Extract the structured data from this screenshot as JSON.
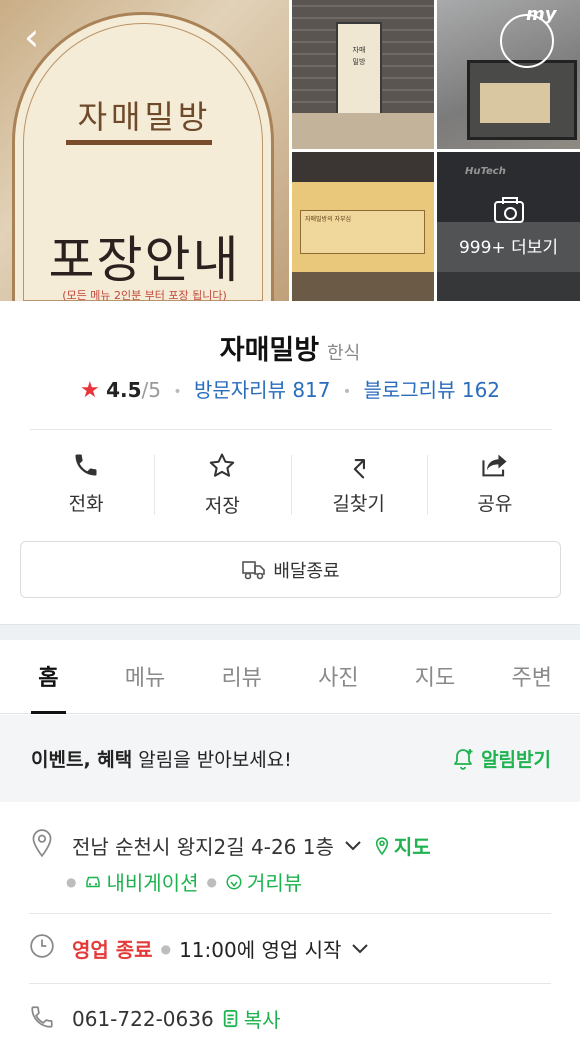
{
  "photos": {
    "poster_title": "자매밀방",
    "poster_heading": "포장안내",
    "poster_note": "(모든 메뉴 2인분 부터 포장 됩니다)",
    "more_label": "999+ 더보기",
    "my_logo_text": "my"
  },
  "place": {
    "name": "자매밀방",
    "category": "한식",
    "rating": "4.5",
    "rating_max": "/5",
    "visitor_reviews": "방문자리뷰 817",
    "blog_reviews": "블로그리뷰 162"
  },
  "actions": [
    {
      "label": "전화",
      "icon": "phone-icon"
    },
    {
      "label": "저장",
      "icon": "star-icon"
    },
    {
      "label": "길찾기",
      "icon": "directions-icon"
    },
    {
      "label": "공유",
      "icon": "share-icon"
    }
  ],
  "delivery": {
    "label": "배달종료",
    "icon": "delivery-icon"
  },
  "tabs": [
    {
      "label": "홈",
      "active": true
    },
    {
      "label": "메뉴"
    },
    {
      "label": "리뷰"
    },
    {
      "label": "사진"
    },
    {
      "label": "지도"
    },
    {
      "label": "주변"
    }
  ],
  "event": {
    "bold1": "이벤트, 혜택",
    "rest": " 알림을 받아보세요!",
    "alarm_label": "알림받기"
  },
  "details": {
    "address": "전남 순천시 왕지2길 4-26 1층",
    "map_label": "지도",
    "navigation_label": "내비게이션",
    "streetview_label": "거리뷰",
    "status": "영업 종료",
    "hours": "11:00에 영업 시작",
    "phone": "061-722-0636",
    "copy_label": "복사"
  },
  "colors": {
    "green": "#1fb34f",
    "red": "#e33a3a",
    "link_blue": "#2a6dbd"
  }
}
